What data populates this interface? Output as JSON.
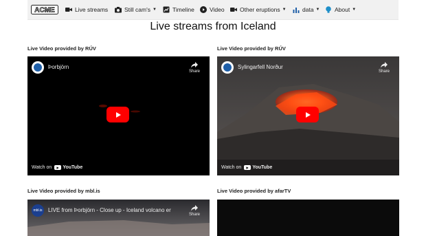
{
  "nav": {
    "logo": "ACME",
    "items": [
      {
        "label": "Live streams",
        "icon": "video-camera-icon",
        "caret": false
      },
      {
        "label": "Still cam's",
        "icon": "camera-icon",
        "caret": true
      },
      {
        "label": "Timeline",
        "icon": "timeline-icon",
        "caret": false
      },
      {
        "label": "Video",
        "icon": "play-circle-icon",
        "caret": false
      },
      {
        "label": "Other eruptions",
        "icon": "video-camera-icon",
        "caret": true
      },
      {
        "label": "data",
        "icon": "bar-chart-icon",
        "caret": true
      },
      {
        "label": "About",
        "icon": "lightbulb-icon",
        "caret": true
      }
    ]
  },
  "page": {
    "title": "Live streams from Iceland"
  },
  "cards": [
    {
      "provider": "Live Video provided by RÚV",
      "video_title": "Þorbjörn",
      "share": "Share",
      "watch_on": "Watch on",
      "yt": "YouTube"
    },
    {
      "provider": "Live Video provided by RÚV",
      "video_title": "Sylingarfell Norður",
      "share": "Share",
      "watch_on": "Watch on",
      "yt": "YouTube"
    },
    {
      "provider": "Live Video provided by mbl.is",
      "video_title": "LIVE from Þorbjörn - Close up - Iceland volcano er",
      "share": "Share"
    },
    {
      "provider": "Live Video provided by afarTV"
    }
  ],
  "colors": {
    "play_red": "#ff0000",
    "lava": "#ff5a1a",
    "nav_bg": "#f1f1f1"
  }
}
